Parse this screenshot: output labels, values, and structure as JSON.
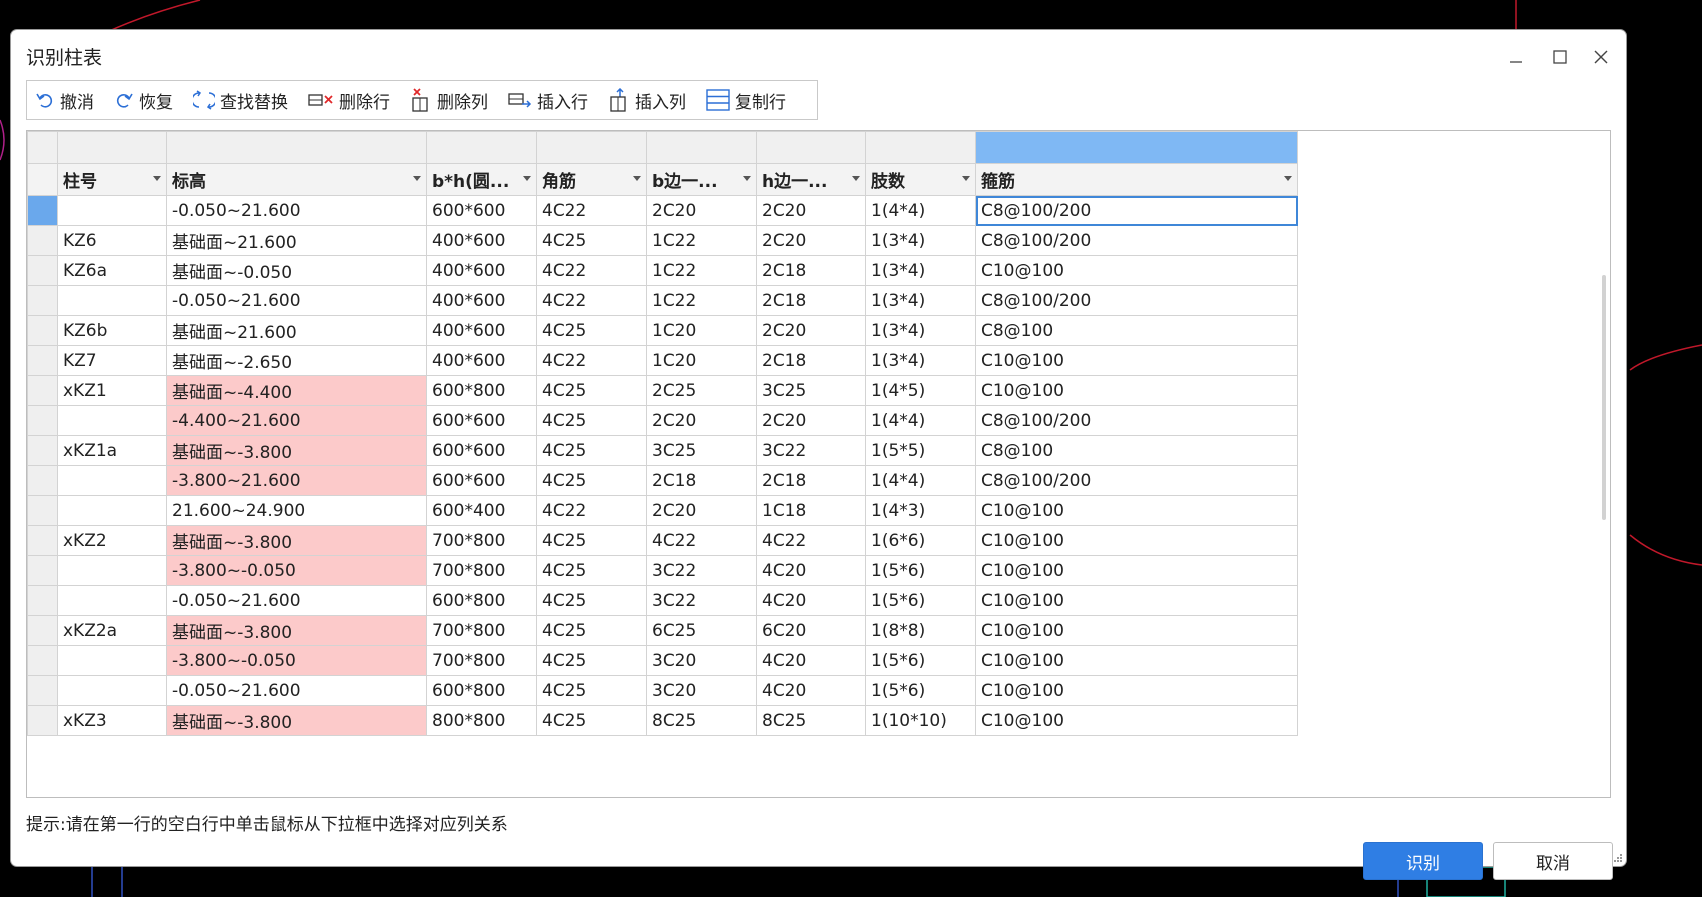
{
  "dialog": {
    "title": "识别柱表",
    "hint": "提示:请在第一行的空白行中单击鼠标从下拉框中选择对应列关系",
    "ok_label": "识别",
    "cancel_label": "取消"
  },
  "toolbar": {
    "undo": "撤消",
    "redo": "恢复",
    "find_replace": "查找替换",
    "delete_row": "删除行",
    "delete_col": "删除列",
    "insert_row": "插入行",
    "insert_col": "插入列",
    "copy_row": "复制行"
  },
  "columns": [
    "柱号",
    "标高",
    "b*h(圆...",
    "角筋",
    "b边一...",
    "h边一...",
    "肢数",
    "箍筋"
  ],
  "rows": [
    [
      "",
      "-0.050~21.600",
      "600*600",
      "4C22",
      "2C20",
      "2C20",
      "1(4*4)",
      "C8@100/200"
    ],
    [
      "KZ6",
      "基础面~21.600",
      "400*600",
      "4C25",
      "1C22",
      "2C20",
      "1(3*4)",
      "C8@100/200"
    ],
    [
      "KZ6a",
      "基础面~-0.050",
      "400*600",
      "4C22",
      "1C22",
      "2C18",
      "1(3*4)",
      "C10@100"
    ],
    [
      "",
      "-0.050~21.600",
      "400*600",
      "4C22",
      "1C22",
      "2C18",
      "1(3*4)",
      "C8@100/200"
    ],
    [
      "KZ6b",
      "基础面~21.600",
      "400*600",
      "4C25",
      "1C20",
      "2C20",
      "1(3*4)",
      "C8@100"
    ],
    [
      "KZ7",
      "基础面~-2.650",
      "400*600",
      "4C22",
      "1C20",
      "2C18",
      "1(3*4)",
      "C10@100"
    ],
    [
      "xKZ1",
      "基础面~-4.400",
      "600*800",
      "4C25",
      "2C25",
      "3C25",
      "1(4*5)",
      "C10@100"
    ],
    [
      "",
      "-4.400~21.600",
      "600*600",
      "4C25",
      "2C20",
      "2C20",
      "1(4*4)",
      "C8@100/200"
    ],
    [
      "xKZ1a",
      "基础面~-3.800",
      "600*600",
      "4C25",
      "3C25",
      "3C22",
      "1(5*5)",
      "C8@100"
    ],
    [
      "",
      "-3.800~21.600",
      "600*600",
      "4C25",
      "2C18",
      "2C18",
      "1(4*4)",
      "C8@100/200"
    ],
    [
      "",
      "21.600~24.900",
      "600*400",
      "4C22",
      "2C20",
      "1C18",
      "1(4*3)",
      "C10@100"
    ],
    [
      "xKZ2",
      "基础面~-3.800",
      "700*800",
      "4C25",
      "4C22",
      "4C22",
      "1(6*6)",
      "C10@100"
    ],
    [
      "",
      "-3.800~-0.050",
      "700*800",
      "4C25",
      "3C22",
      "4C20",
      "1(5*6)",
      "C10@100"
    ],
    [
      "",
      "-0.050~21.600",
      "600*800",
      "4C25",
      "3C22",
      "4C20",
      "1(5*6)",
      "C10@100"
    ],
    [
      "xKZ2a",
      "基础面~-3.800",
      "700*800",
      "4C25",
      "6C25",
      "6C20",
      "1(8*8)",
      "C10@100"
    ],
    [
      "",
      "-3.800~-0.050",
      "700*800",
      "4C25",
      "3C20",
      "4C20",
      "1(5*6)",
      "C10@100"
    ],
    [
      "",
      "-0.050~21.600",
      "600*800",
      "4C25",
      "3C20",
      "4C20",
      "1(5*6)",
      "C10@100"
    ],
    [
      "xKZ3",
      "基础面~-3.800",
      "800*800",
      "4C25",
      "8C25",
      "8C25",
      "1(10*10)",
      "C10@100"
    ]
  ],
  "pink_rows": [
    6,
    7,
    8,
    9,
    11,
    12,
    14,
    15,
    17
  ],
  "colors": {
    "accent": "#2f7ee4",
    "header_highlight": "#7fb8f4",
    "pink": "#fccaca"
  }
}
